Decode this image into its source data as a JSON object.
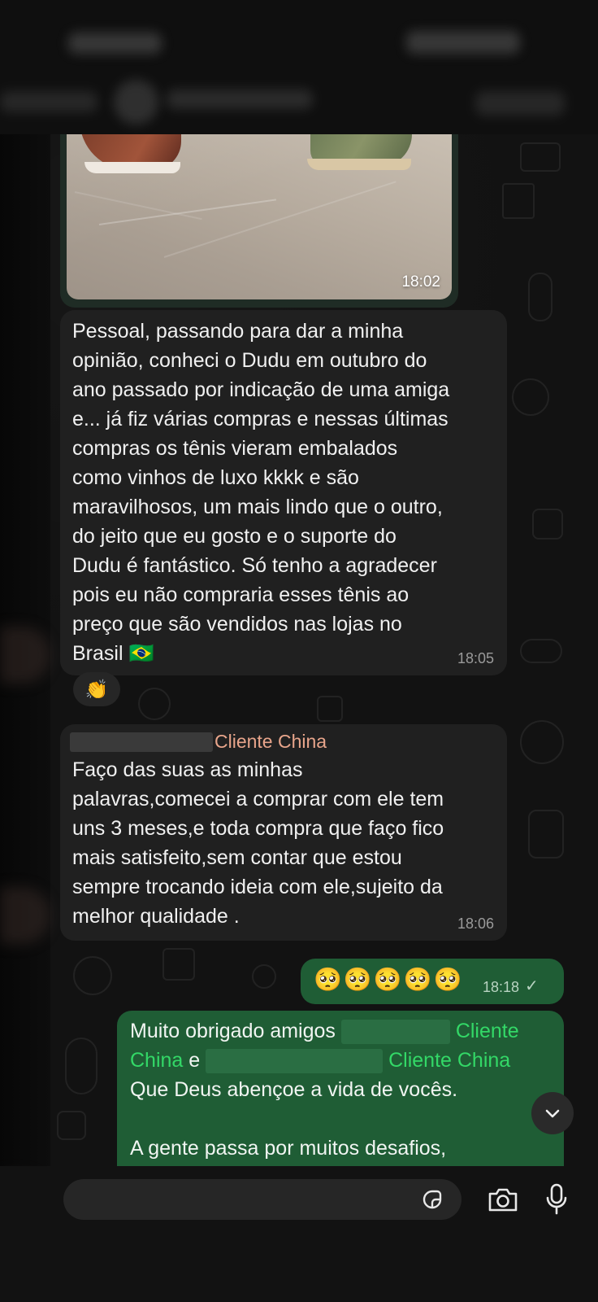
{
  "header": {
    "contact_name": "",
    "status_text": ""
  },
  "messages": {
    "image_message": {
      "time": "18:02"
    },
    "message_1": {
      "text": "Pessoal, passando para dar a minha\nopinião, conheci o Dudu em outubro do\nano passado por indicação de uma amiga\ne... já fiz várias compras e nessas últimas\ncompras os tênis vieram embalados\ncomo vinhos de luxo kkkk e são\nmaravilhosos, um mais lindo que o outro,\ndo jeito que eu gosto e o suporte do\nDudu é fantástico. Só tenho a agradecer\npois eu não compraria esses tênis ao\npreço que são vendidos nas lojas no\nBrasil 🇧🇷",
      "time": "18:05",
      "reaction": "👏"
    },
    "message_2": {
      "sender_suffix": "Cliente China",
      "text": "Faço das suas as minhas\npalavras,comecei a comprar com ele tem\nuns 3 meses,e toda compra que faço fico\nmais satisfeito,sem contar que estou\nsempre trocando ideia com ele,sujeito da\nmelhor qualidade .",
      "time": "18:06"
    },
    "message_3": {
      "text": "🥺🥺🥺🥺🥺",
      "time": "18:18",
      "status": "✓"
    },
    "message_4": {
      "line1_prefix": "Muito obrigado amigos",
      "mention1_suffix": "Cliente",
      "line2_mention1_end": "China",
      "line2_and": "e",
      "mention2_suffix": "Cliente China",
      "line3": "Que Deus abençoe a vida de vocês.",
      "line5": "A gente passa por muitos desafios,"
    }
  },
  "colors": {
    "incoming_bubble": "#202020",
    "outgoing_bubble": "#1f5d35",
    "mention_green": "#33d867",
    "sender_name": "#e8a58b"
  },
  "icons": {
    "scroll_down": "chevron-down-icon",
    "sticker": "sticker-icon",
    "camera": "camera-icon",
    "mic": "microphone-icon"
  }
}
